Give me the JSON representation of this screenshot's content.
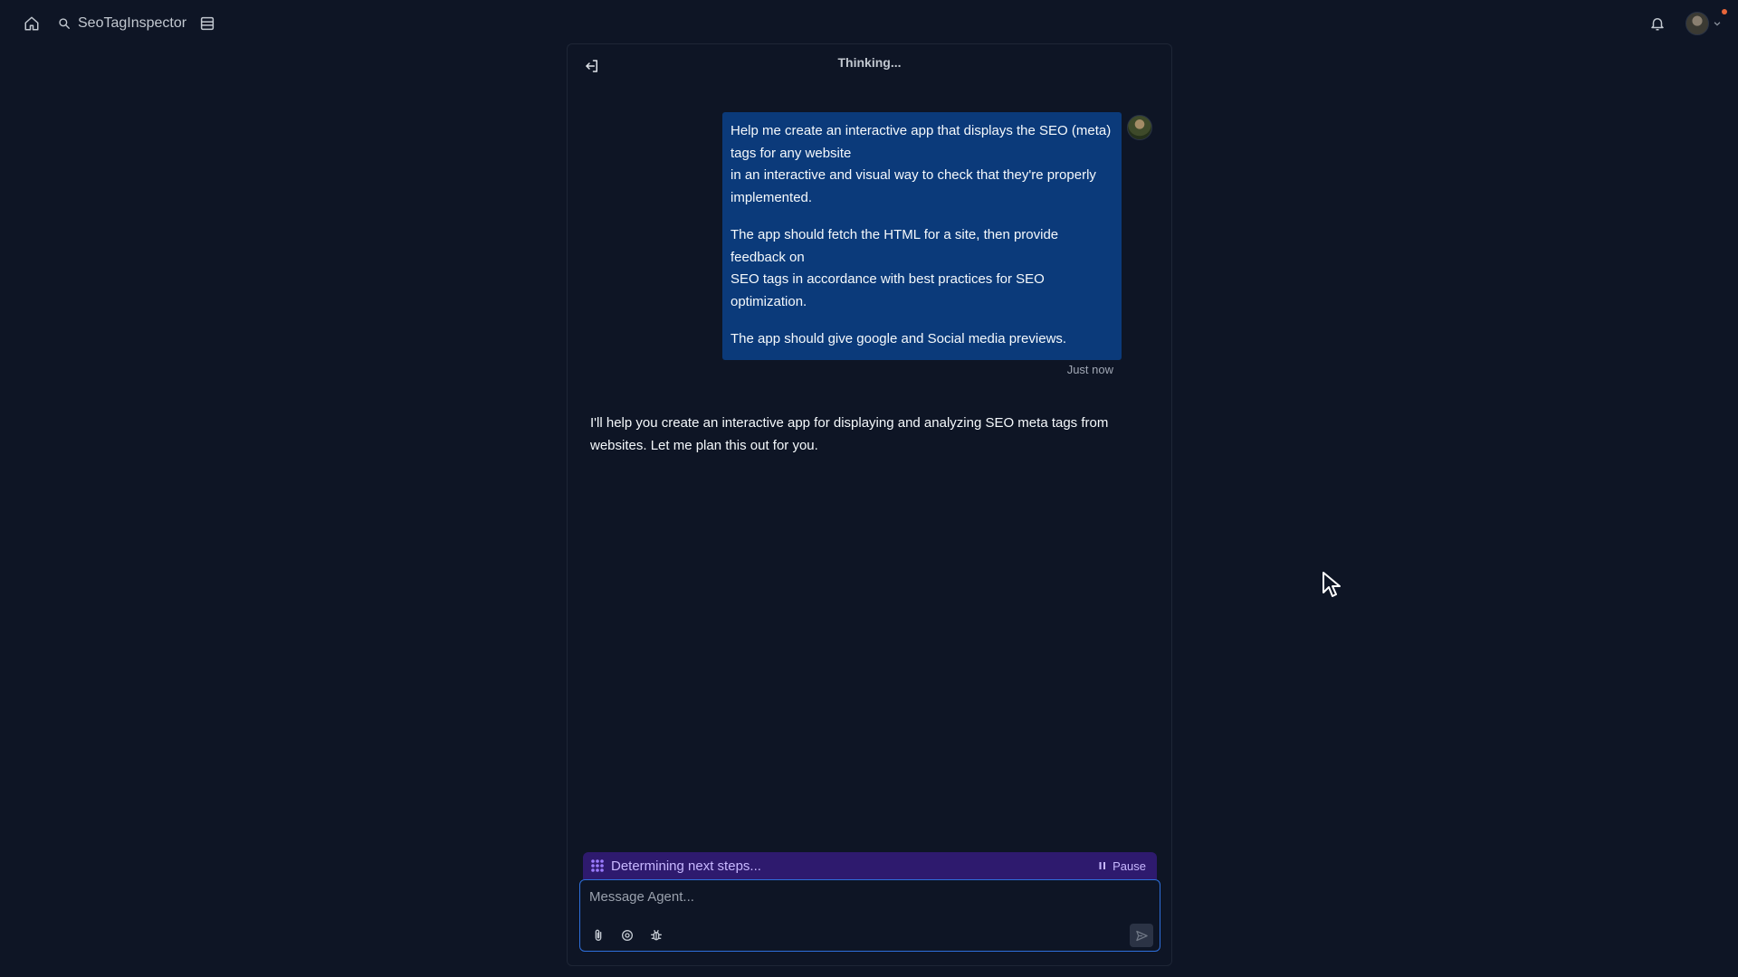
{
  "topbar": {
    "app_name": "SeoTagInspector",
    "icons": [
      "home-icon",
      "search-icon",
      "layout-icon",
      "bell-icon",
      "avatar"
    ]
  },
  "chat": {
    "status_title": "Thinking...",
    "user_message": {
      "paragraphs": [
        "Help me create an interactive app that displays the SEO (meta) tags for any website\nin an interactive and visual way to check that they're properly implemented.",
        "The app should fetch the HTML for a site, then provide feedback on\nSEO tags in accordance with best practices for SEO optimization.",
        "The app should give google and Social media previews."
      ],
      "timestamp": "Just now"
    },
    "agent_message": "I'll help you create an interactive app for displaying and analyzing SEO meta tags from websites. Let me plan this out for you."
  },
  "agent_status": {
    "text": "Determining next steps...",
    "pause_label": "Pause"
  },
  "composer": {
    "placeholder": "Message Agent...",
    "value": ""
  },
  "colors": {
    "background": "#0e1525",
    "user_bubble": "#0b3a7a",
    "status_bar": "#2e1a6e",
    "status_text": "#c8b8ff",
    "input_border": "#2e6fdb",
    "notification_dot": "#e8663a"
  }
}
